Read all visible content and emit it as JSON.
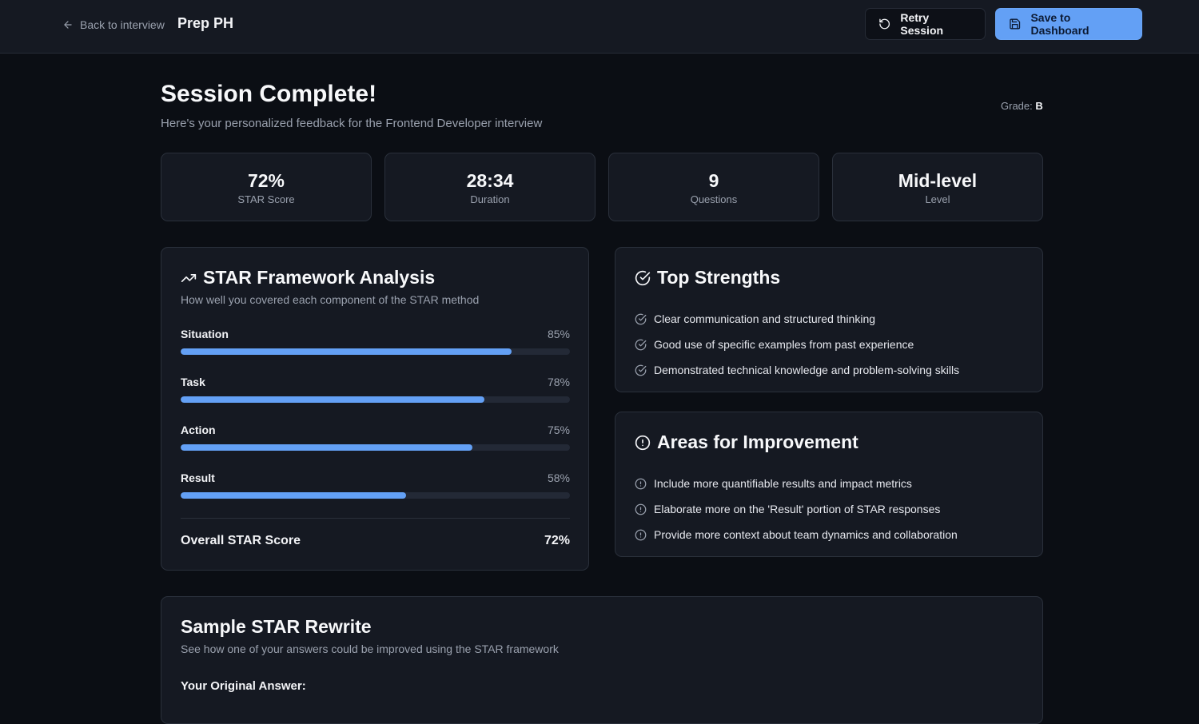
{
  "header": {
    "back_label": "Back to interview",
    "brand": "Prep PH",
    "retry_label": "Retry Session",
    "save_label": "Save to Dashboard"
  },
  "summary": {
    "title": "Session Complete!",
    "subtitle": "Here's your personalized feedback for the Frontend Developer interview",
    "grade_label": "Grade:",
    "grade_value": "B"
  },
  "stats": [
    {
      "value": "72%",
      "label": "STAR Score"
    },
    {
      "value": "28:34",
      "label": "Duration"
    },
    {
      "value": "9",
      "label": "Questions"
    },
    {
      "value": "Mid-level",
      "label": "Level"
    }
  ],
  "star_analysis": {
    "title": "STAR Framework Analysis",
    "subtitle": "How well you covered each component of the STAR method",
    "components": [
      {
        "name": "Situation",
        "pct_label": "85%",
        "value": 85
      },
      {
        "name": "Task",
        "pct_label": "78%",
        "value": 78
      },
      {
        "name": "Action",
        "pct_label": "75%",
        "value": 75
      },
      {
        "name": "Result",
        "pct_label": "58%",
        "value": 58
      }
    ],
    "overall_label": "Overall STAR Score",
    "overall_value": "72%"
  },
  "strengths": {
    "title": "Top Strengths",
    "items": [
      "Clear communication and structured thinking",
      "Good use of specific examples from past experience",
      "Demonstrated technical knowledge and problem-solving skills"
    ]
  },
  "improvements": {
    "title": "Areas for Improvement",
    "items": [
      "Include more quantifiable results and impact metrics",
      "Elaborate more on the 'Result' portion of STAR responses",
      "Provide more context about team dynamics and collaboration"
    ]
  },
  "rewrite": {
    "title": "Sample STAR Rewrite",
    "subtitle": "See how one of your answers could be improved using the STAR framework",
    "original_label": "Your Original Answer:"
  },
  "colors": {
    "accent": "#63a0f5",
    "background": "#0b0e14",
    "card": "#151922"
  }
}
